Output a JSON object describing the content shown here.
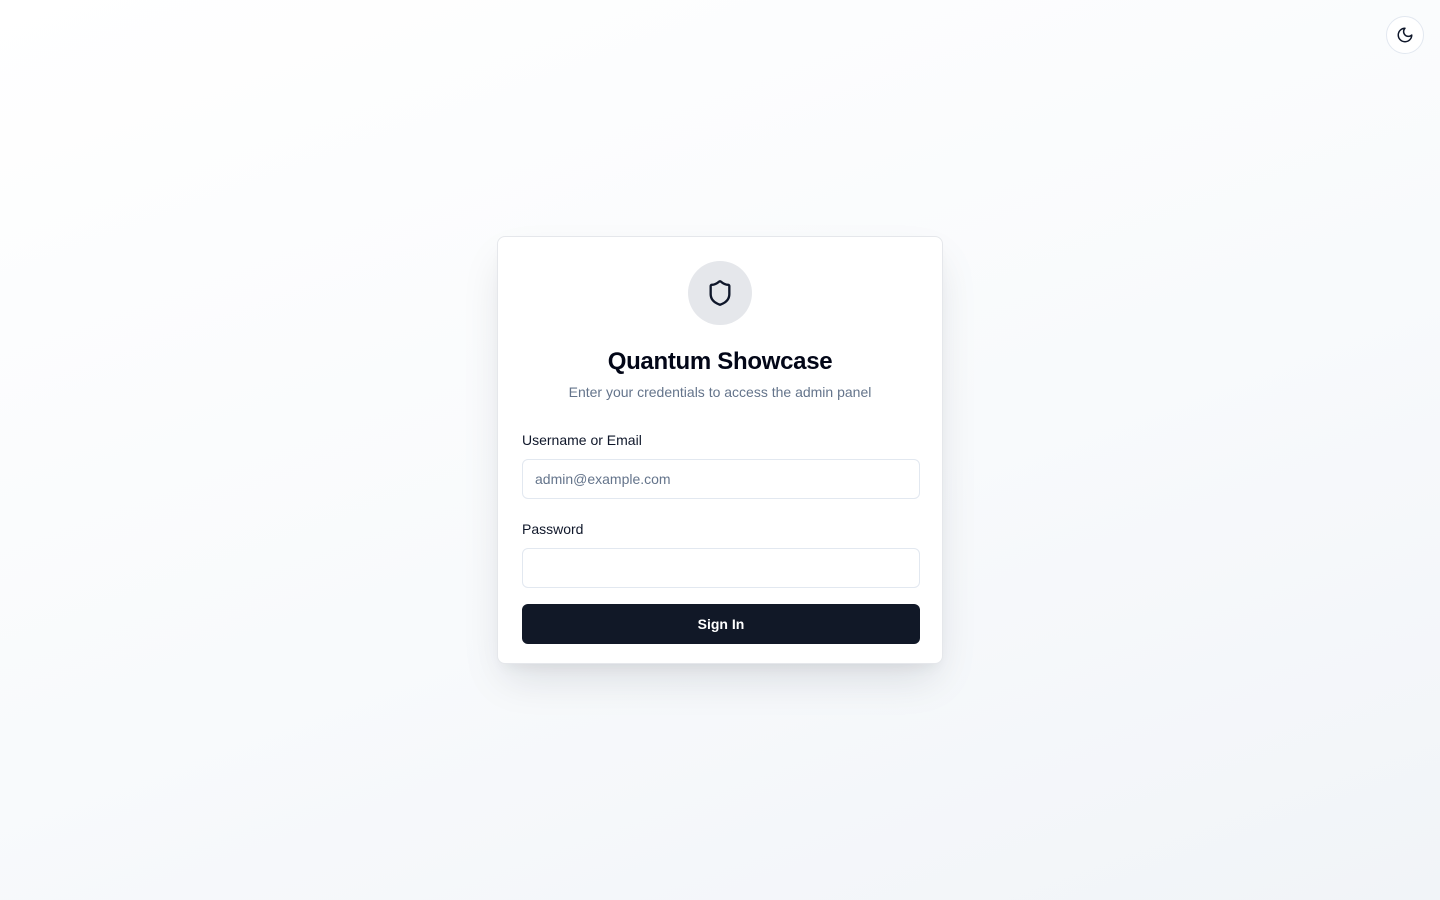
{
  "theme_toggle": {
    "icon": "moon-icon"
  },
  "login": {
    "logo_icon": "shield-icon",
    "title": "Quantum Showcase",
    "subtitle": "Enter your credentials to access the admin panel",
    "username": {
      "label": "Username or Email",
      "placeholder": "admin@example.com",
      "value": ""
    },
    "password": {
      "label": "Password",
      "placeholder": "",
      "value": ""
    },
    "submit_label": "Sign In"
  },
  "colors": {
    "primary_button": "#111827",
    "muted_text": "#64748b",
    "icon_circle": "#e5e7eb",
    "border": "#e2e8f0"
  }
}
